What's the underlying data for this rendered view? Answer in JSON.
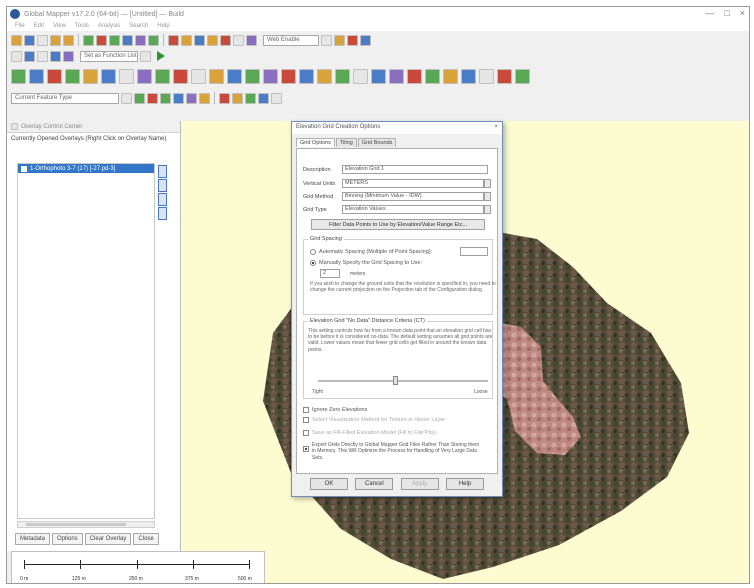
{
  "window": {
    "title": "Global Mapper v17.2.0 (64-bit) — [Untitled] — Build",
    "controls": [
      "—",
      "□",
      "×"
    ]
  },
  "menu": [
    "File",
    "Edit",
    "View",
    "Tools",
    "Analysis",
    "Search",
    "Help"
  ],
  "toolbar": {
    "map_style_combo": "Web Enable",
    "layer_combo": "Set as Function List",
    "feature_type_combo": "Current Feature Type"
  },
  "control_center": {
    "title": "Overlay Control Center",
    "caption": "Currently Opened Overlays (Right Click on Overlay Name)",
    "layer_name": "1-Orthophoto 3-7 (17) [-27.pd-3]",
    "tabs": [
      "Metadata",
      "Options",
      "Clear Overlay",
      "Close"
    ]
  },
  "scale": {
    "labels": [
      "0 m",
      "125 m",
      "250 m",
      "375 m",
      "500 m"
    ]
  },
  "dialog": {
    "title": "Elevation Grid Creation Options",
    "close": "×",
    "tabs": [
      "Grid Options",
      "Tiling",
      "Grid Bounds"
    ],
    "fields": {
      "name_label": "Description",
      "name_value": "Elevation Grid 1",
      "units_label": "Vertical Units",
      "units_value": "METERS",
      "method_label": "Grid Method",
      "method_value": "Binning (Minimum Value - IDW)",
      "type_label": "Grid Type",
      "type_value": "Elevation Values"
    },
    "filter_button": "Filter Data Points to Use by Elevation/Value Range Etc...",
    "spacing": {
      "group_title": "Grid Spacing",
      "auto_option": "Automatic Spacing (Multiple of Point Spacing):",
      "manual_option": "Manually Specify the Grid Spacing to Use:",
      "manual_value": "2",
      "units": "meters",
      "note": "If you wish to change the ground units that the resolution is specified in, you need to change the current projection on the Projection tab of the Configuration dialog."
    },
    "threshold": {
      "group_title": "Elevation Grid \"No Data\" Distance Criteria (CT)",
      "note": "This setting controls how far from a known data point that an elevation grid cell has to be before it is considered no-data. The default setting assumes all grid points are valid. Lower values mean that fewer grid cells get filled in around the known data points.",
      "left_label": "Tight",
      "right_label": "Loose",
      "level": 0.45
    },
    "options": [
      {
        "label": "Ignore Zero Elevations",
        "checked": false,
        "enabled": true
      },
      {
        "label": "Select Visualization Method for Texture in Vector Layer",
        "checked": false,
        "enabled": false
      },
      {
        "label": "Save as Fill-Filled Elevation Model (Fill to Flat Pits)",
        "checked": false,
        "enabled": false
      },
      {
        "label": "Export Grids Directly to Global Mapper Grid Files Rather Than Storing them in Memory. This Will Optimize the Process for Handling of Very Large Data Sets.",
        "checked": true,
        "enabled": true
      }
    ],
    "buttons": {
      "ok": "OK",
      "cancel": "Cancel",
      "apply": "Apply",
      "help": "Help"
    }
  },
  "colors": {
    "map_background": "#fdfbd0",
    "selection": "#3276c9"
  }
}
